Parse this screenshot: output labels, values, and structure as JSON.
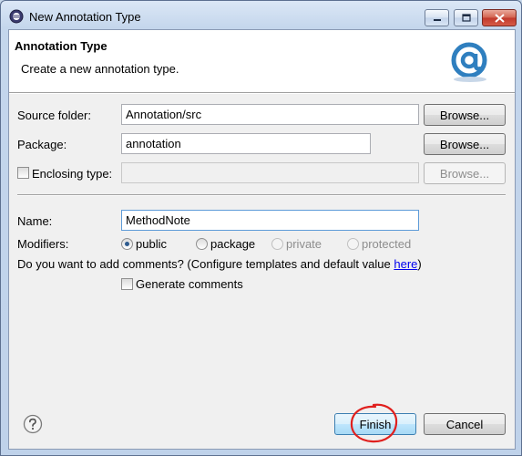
{
  "window": {
    "title": "New Annotation Type"
  },
  "banner": {
    "title": "Annotation Type",
    "description": "Create a new annotation type."
  },
  "form": {
    "source_folder": {
      "label": "Source folder:",
      "value": "Annotation/src",
      "button": "Browse..."
    },
    "package": {
      "label": "Package:",
      "value": "annotation",
      "button": "Browse..."
    },
    "enclosing_type": {
      "label": "Enclosing type:",
      "value": "",
      "button": "Browse...",
      "checked": false
    },
    "name": {
      "label": "Name:",
      "value": "MethodNote"
    },
    "modifiers": {
      "label": "Modifiers:",
      "options": [
        "public",
        "package",
        "private",
        "protected"
      ],
      "selected": "public"
    },
    "comments": {
      "question": "Do you want to add comments? (Configure templates and default value ",
      "link": "here",
      "suffix": ")",
      "generate_label": "Generate comments",
      "generate_checked": false
    }
  },
  "footer": {
    "finish": "Finish",
    "cancel": "Cancel"
  },
  "colors": {
    "accent": "#3c7fb1",
    "logo": "#2f7fbf",
    "annotation": "#e0201e"
  }
}
